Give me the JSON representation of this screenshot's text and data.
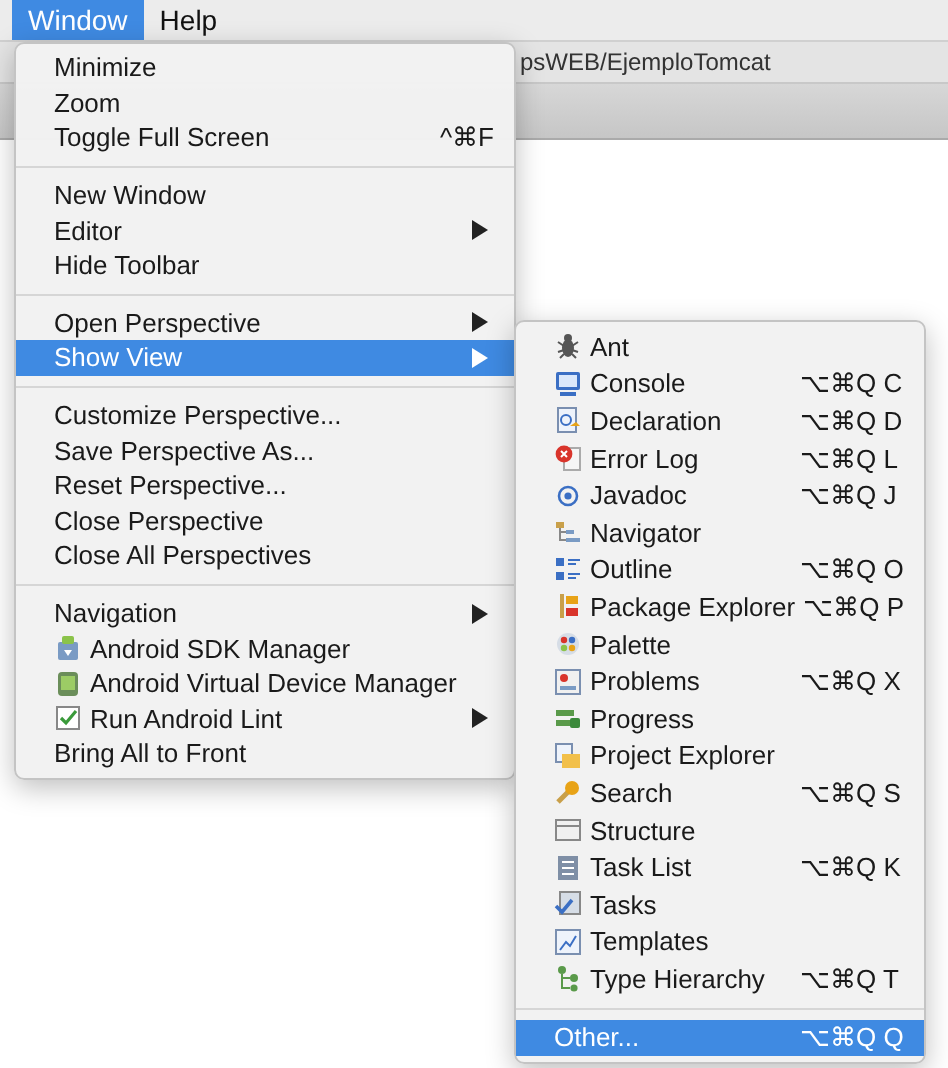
{
  "menubar": [
    {
      "label": "Window",
      "selected": true
    },
    {
      "label": "Help",
      "selected": false
    }
  ],
  "window": {
    "title": "psWEB/EjemploTomcat"
  },
  "menu": {
    "groups": [
      [
        {
          "label": "Minimize",
          "selected": false
        },
        {
          "label": "Zoom",
          "selected": false
        },
        {
          "label": "Toggle Full Screen",
          "shortcut": "^⌘F",
          "selected": false
        }
      ],
      [
        {
          "label": "New Window",
          "selected": false
        },
        {
          "label": "Editor",
          "submenu": true,
          "selected": false
        },
        {
          "label": "Hide Toolbar",
          "selected": false
        }
      ],
      [
        {
          "label": "Open Perspective",
          "submenu": true,
          "selected": false
        },
        {
          "label": "Show View",
          "submenu": true,
          "selected": true
        }
      ],
      [
        {
          "label": "Customize Perspective...",
          "selected": false
        },
        {
          "label": "Save Perspective As...",
          "selected": false
        },
        {
          "label": "Reset Perspective...",
          "selected": false
        },
        {
          "label": "Close Perspective",
          "selected": false
        },
        {
          "label": "Close All Perspectives",
          "selected": false
        }
      ],
      [
        {
          "label": "Navigation",
          "submenu": true,
          "selected": false
        },
        {
          "label": "Android SDK Manager",
          "has_icon": true,
          "selected": false
        },
        {
          "label": "Android Virtual Device Manager",
          "has_icon": true,
          "selected": false
        },
        {
          "label": "Run Android Lint",
          "has_icon": true,
          "submenu": true,
          "selected": false
        },
        {
          "label": "Bring All to Front",
          "selected": false
        }
      ]
    ]
  },
  "submenu": {
    "groups": [
      [
        {
          "label": "Ant",
          "has_icon": true,
          "selected": false
        },
        {
          "label": "Console",
          "shortcut": "⌥⌘Q C",
          "has_icon": true,
          "selected": false
        },
        {
          "label": "Declaration",
          "shortcut": "⌥⌘Q D",
          "has_icon": true,
          "selected": false
        },
        {
          "label": "Error Log",
          "shortcut": "⌥⌘Q L",
          "has_icon": true,
          "selected": false
        },
        {
          "label": "Javadoc",
          "shortcut": "⌥⌘Q J",
          "has_icon": true,
          "selected": false
        },
        {
          "label": "Navigator",
          "has_icon": true,
          "selected": false
        },
        {
          "label": "Outline",
          "shortcut": "⌥⌘Q O",
          "has_icon": true,
          "selected": false
        },
        {
          "label": "Package Explorer",
          "shortcut": "⌥⌘Q P",
          "has_icon": true,
          "selected": false
        },
        {
          "label": "Palette",
          "has_icon": true,
          "selected": false
        },
        {
          "label": "Problems",
          "shortcut": "⌥⌘Q X",
          "has_icon": true,
          "selected": false
        },
        {
          "label": "Progress",
          "has_icon": true,
          "selected": false
        },
        {
          "label": "Project Explorer",
          "has_icon": true,
          "selected": false
        },
        {
          "label": "Search",
          "shortcut": "⌥⌘Q S",
          "has_icon": true,
          "selected": false
        },
        {
          "label": "Structure",
          "has_icon": true,
          "selected": false
        },
        {
          "label": "Task List",
          "shortcut": "⌥⌘Q K",
          "has_icon": true,
          "selected": false
        },
        {
          "label": "Tasks",
          "has_icon": true,
          "selected": false
        },
        {
          "label": "Templates",
          "has_icon": true,
          "selected": false
        },
        {
          "label": "Type Hierarchy",
          "shortcut": "⌥⌘Q T",
          "has_icon": true,
          "selected": false
        }
      ],
      [
        {
          "label": "Other...",
          "shortcut": "⌥⌘Q Q",
          "selected": true
        }
      ]
    ]
  }
}
